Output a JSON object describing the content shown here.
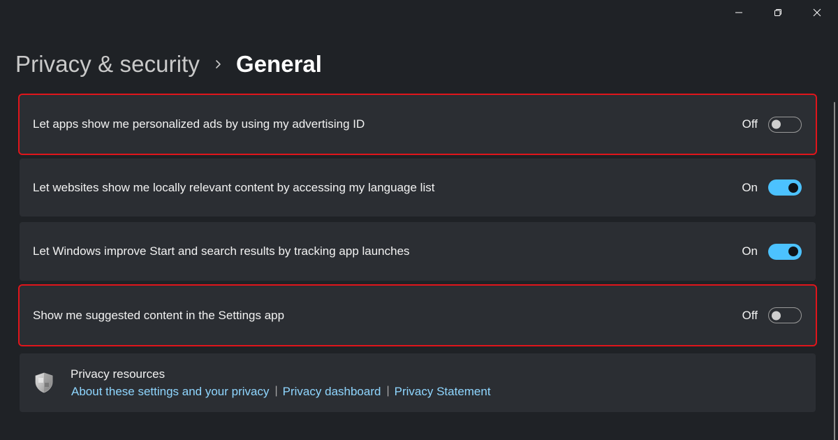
{
  "window_controls": {
    "minimize_icon": "minimize-icon",
    "maximize_icon": "restore-icon",
    "close_icon": "close-icon"
  },
  "breadcrumb": {
    "parent": "Privacy & security",
    "separator_icon": "chevron-right-icon",
    "current": "General"
  },
  "settings": {
    "advertising_id": {
      "label": "Let apps show me personalized ads by using my advertising ID",
      "state": "Off",
      "enabled": false,
      "highlighted": true
    },
    "language_list": {
      "label": "Let websites show me locally relevant content by accessing my language list",
      "state": "On",
      "enabled": true,
      "highlighted": false
    },
    "app_launch_tracking": {
      "label": "Let Windows improve Start and search results by tracking app launches",
      "state": "On",
      "enabled": true,
      "highlighted": false
    },
    "suggested_content": {
      "label": "Show me suggested content in the Settings app",
      "state": "Off",
      "enabled": false,
      "highlighted": true
    }
  },
  "privacy_resources": {
    "icon": "shield-icon",
    "title": "Privacy resources",
    "links": [
      "About these settings and your privacy",
      "Privacy dashboard",
      "Privacy Statement"
    ],
    "divider": "|"
  },
  "colors": {
    "background": "#1f2226",
    "card": "#2b2e33",
    "accent": "#4cc2ff",
    "link": "#8fd6ff",
    "highlight_outline": "#e0151b"
  }
}
